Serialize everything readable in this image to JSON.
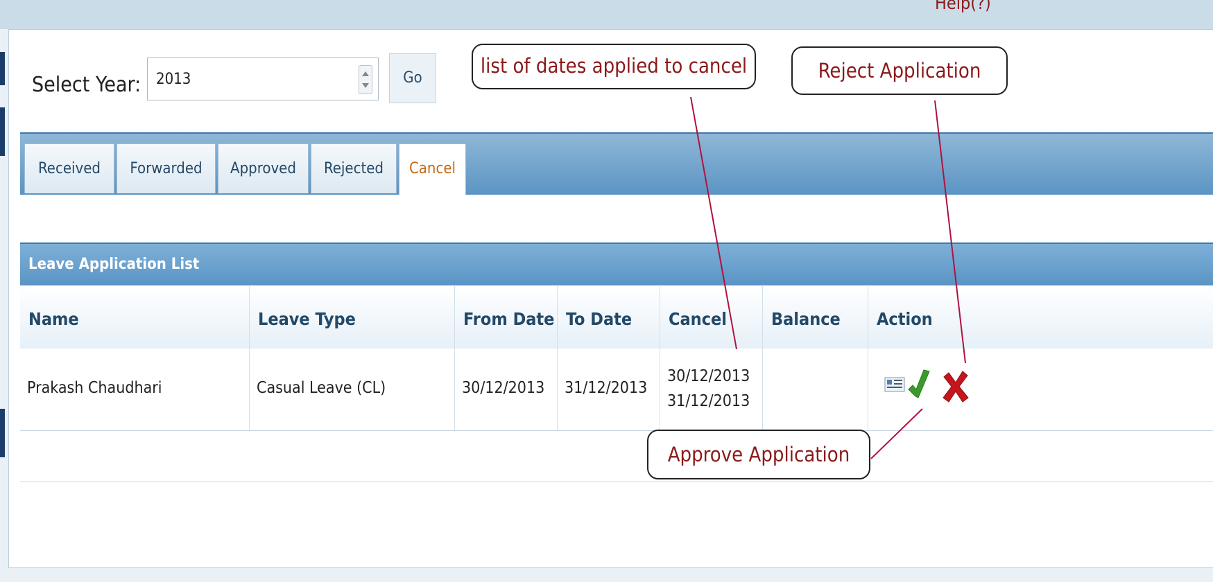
{
  "help_text": "Help(?)",
  "year_selector": {
    "label": "Select Year:",
    "value": "2013",
    "go_label": "Go"
  },
  "tabs": [
    {
      "label": "Received"
    },
    {
      "label": "Forwarded"
    },
    {
      "label": "Approved"
    },
    {
      "label": "Rejected"
    },
    {
      "label": "Cancel"
    }
  ],
  "active_tab": "Cancel",
  "list": {
    "title": "Leave Application List",
    "columns": [
      "Name",
      "Leave Type",
      "From Date",
      "To Date",
      "Cancel",
      "Balance",
      "Action"
    ],
    "rows": [
      {
        "name": "Prakash Chaudhari",
        "leave_type": "Casual Leave (CL)",
        "from_date": "30/12/2013",
        "to_date": "31/12/2013",
        "cancel_dates": [
          "30/12/2013",
          "31/12/2013"
        ],
        "balance": "",
        "actions": [
          "details-icon",
          "approve-check-icon",
          "reject-x-icon"
        ]
      }
    ]
  },
  "annotations": {
    "cancel_dates": "list of dates applied to cancel",
    "reject": "Reject Application",
    "approve": "Approve Application"
  },
  "colors": {
    "accent_blue": "#5a94c4",
    "annotation_text": "#8b1a1a",
    "active_tab_text": "#c56a13",
    "approve_green": "#3a9a2c",
    "reject_red": "#c4161c"
  }
}
